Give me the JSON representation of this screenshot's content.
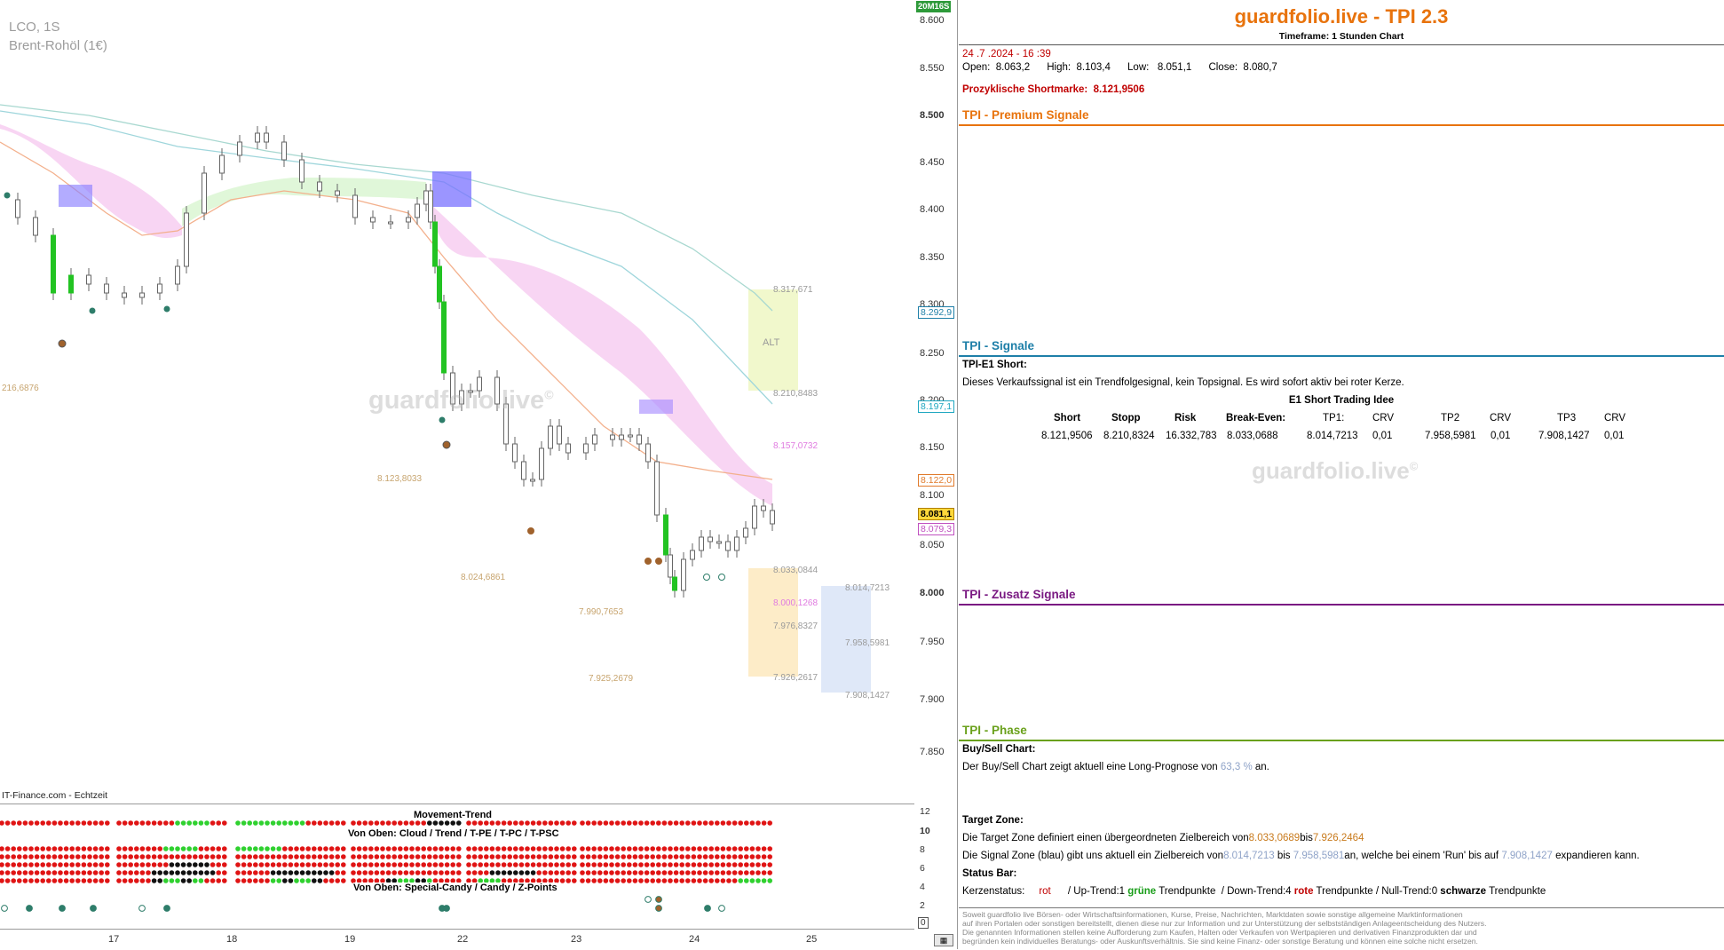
{
  "chart": {
    "symbol": "LCO, 1S",
    "name": "Brent-Rohöl (1€)",
    "source": "IT-Finance.com - Echtzeit",
    "watermark": "guardfolio.live",
    "watermark_symbol": "©",
    "timer_badge": "20M16S",
    "alt_label": "ALT",
    "y_ticks": [
      "8.600",
      "8.550",
      "8.500",
      "8.450",
      "8.400",
      "8.350",
      "8.300",
      "8.250",
      "8.200",
      "8.150",
      "8.100",
      "8.050",
      "8.000",
      "7.950",
      "7.900",
      "7.850"
    ],
    "y_boxes": {
      "a": "8.292,9",
      "b": "8.197,1",
      "c": "8.122,0",
      "d": "8.081,1",
      "e": "8.079,3"
    },
    "x_ticks": [
      "17",
      "18",
      "19",
      "22",
      "23",
      "24",
      "25"
    ],
    "price_labels": {
      "p1": "216,6876",
      "p2": "8.123,8033",
      "p3": "8.024,6861",
      "p4": "7.990,7653",
      "p5": "7.925,2679",
      "p6": "8.317,671",
      "p7": "8.210,8483",
      "p8": "8.157,0732",
      "p9": "8.033,0844",
      "p10": "8.000,1268",
      "p11": "7.976,8327",
      "p12": "7.926,2617",
      "p13": "8.014,7213",
      "p14": "7.958,5981",
      "p15": "7.908,1427"
    }
  },
  "indicator": {
    "title": "Movement-Trend",
    "row_label_1": "Von Oben: Cloud / Trend / T-PE / T-PC / T-PSC",
    "row_label_2": "Von Oben: Special-Candy / Candy / Z-Points",
    "y_ticks": [
      "12",
      "10",
      "8",
      "6",
      "4",
      "2",
      "0"
    ]
  },
  "panel": {
    "title": "guardfolio.live - TPI 2.3",
    "timeframe": "Timeframe: 1 Stunden Chart",
    "datetime": "24 .7 .2024 - 16 :39",
    "ohlc": "Open:  8.063,2      High:  8.103,4      Low:   8.051,1      Close:  8.080,7",
    "short_mark_label": "Prozyklische Shortmarke:",
    "short_mark_value": "8.121,9506",
    "sections": {
      "premium": "TPI - Premium Signale",
      "signale": "TPI - Signale",
      "zusatz": "TPI - Zusatz Signale",
      "phase": "TPI - Phase"
    },
    "e1_title": "TPI-E1 Short:",
    "e1_desc": "Dieses Verkaufssignal ist ein Trendfolgesignal, kein Topsignal. Es wird sofort aktiv bei roter Kerze.",
    "idea_title": "E1 Short Trading Idee",
    "table_headers": [
      "Short",
      "Stopp",
      "Risk",
      "Break-Even:",
      "TP1:",
      "CRV",
      "TP2",
      "CRV",
      "TP3",
      "CRV"
    ],
    "table_values": [
      "8.121,9506",
      "8.210,8324",
      "16.332,783",
      "8.033,0688",
      "8.014,7213",
      "0,01",
      "7.958,5981",
      "0,01",
      "7.908,1427",
      "0,01"
    ],
    "buysell_title": "Buy/Sell Chart:",
    "buysell_text_pre": "Der Buy/Sell Chart zeigt aktuell eine Long-Prognose von",
    "buysell_value": "63,3 %",
    "buysell_text_post": "an.",
    "target_title": "Target Zone:",
    "target_text_pre": "Die Target Zone definiert einen übergeordneten Zielbereich von",
    "target_from": "8.033,0689",
    "target_mid": "bis",
    "target_to": "7.926,2464",
    "signal_text_pre": "Die Signal Zone (blau) gibt uns aktuell ein Zielbereich von",
    "signal_from": "8.014,7213",
    "signal_mid": "bis",
    "signal_to": "7.958,5981",
    "signal_text_mid": "an, welche bei einem 'Run' bis auf",
    "signal_run": "7.908,1427",
    "signal_text_post": "expandieren kann.",
    "status_title": "Status Bar:",
    "status_k": "Kerzenstatus:",
    "status_rot": "rot",
    "status_up": "/ Up-Trend:1",
    "status_gruene": "grüne",
    "status_tp1": "Trendpunkte  / Down-Trend:4",
    "status_rote": "rote",
    "status_tp2": "Trendpunkte / Null-Trend:0",
    "status_schwarze": "schwarze",
    "status_tp3": "Trendpunkte",
    "disclaimer": [
      "Soweit guardfolio live Börsen- oder Wirtschaftsinformationen, Kurse, Preise, Nachrichten, Marktdaten sowie sonstige allgemeine Marktinformationen",
      "auf ihren Portalen oder sonstigen bereitstellt, dienen diese nur zur Information und zur Unterstützung der selbstständigen Anlageentscheidung des Nutzers.",
      "Die genannten Informationen stellen keine Aufforderung zum Kaufen, Halten oder Verkaufen von Wertpapieren und derivativen Finanzprodukten dar und",
      "begründen kein individuelles Beratungs- oder Auskunftsverhältnis. Sie sind keine Finanz- oder sonstige Beratung und können eine solche nicht ersetzen."
    ]
  },
  "colors": {
    "title_orange": "#e8730c",
    "premium": "#e8730c",
    "signale": "#1e7fa8",
    "zusatz": "#7a1a82",
    "phase": "#6aa11c",
    "bull_candle": "#22c322",
    "cloud_pink": "#f6cbf0",
    "cloud_green": "#d8f5d0"
  }
}
